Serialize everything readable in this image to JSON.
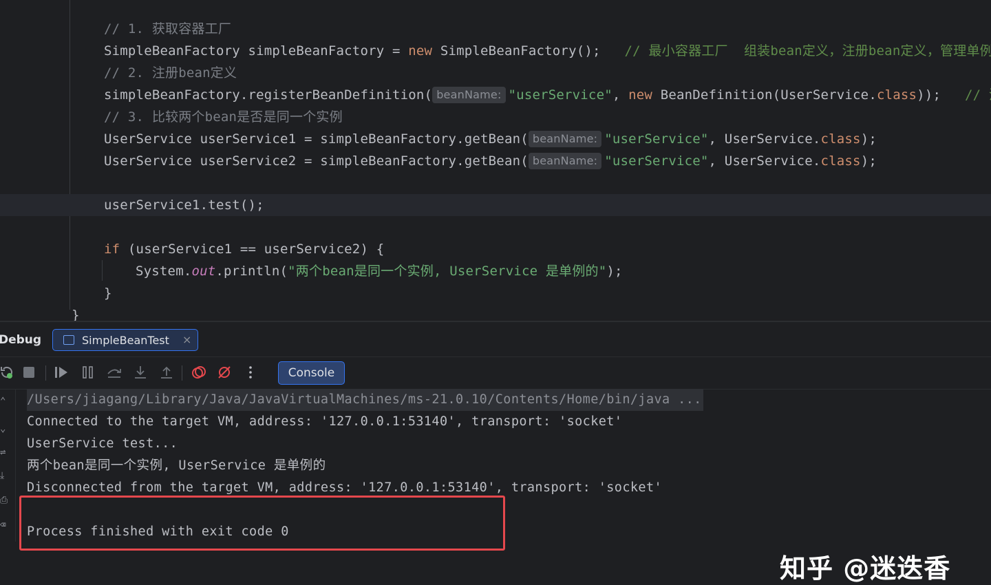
{
  "editor": {
    "lines": [
      {
        "id": "l1",
        "parts": [
          {
            "c": "cm",
            "t": "// 1. 获取容器工厂"
          }
        ]
      },
      {
        "id": "l2",
        "parts": [
          {
            "t": "SimpleBeanFactory simpleBeanFactory = "
          },
          {
            "c": "kw",
            "t": "new"
          },
          {
            "t": " SimpleBeanFactory();   "
          },
          {
            "c": "cmi",
            "t": "// 最小容器工厂  组装bean定义，注册bean定义，管理单例b"
          }
        ]
      },
      {
        "id": "l3",
        "parts": [
          {
            "c": "cm",
            "t": "// 2. 注册bean定义"
          }
        ]
      },
      {
        "id": "l4",
        "parts": [
          {
            "t": "simpleBeanFactory.registerBeanDefinition("
          },
          {
            "c": "hint",
            "t": "beanName:"
          },
          {
            "c": "str",
            "t": "\"userService\""
          },
          {
            "t": ", "
          },
          {
            "c": "kw",
            "t": "new"
          },
          {
            "t": " BeanDefinition(UserService."
          },
          {
            "c": "kw",
            "t": "class"
          },
          {
            "t": "));   "
          },
          {
            "c": "cmi",
            "t": "// 注"
          }
        ]
      },
      {
        "id": "l5",
        "parts": [
          {
            "c": "cm",
            "t": "// 3. 比较两个bean是否是同一个实例"
          }
        ]
      },
      {
        "id": "l6",
        "parts": [
          {
            "t": "UserService userService1 = simpleBeanFactory.getBean("
          },
          {
            "c": "hint",
            "t": "beanName:"
          },
          {
            "c": "str",
            "t": "\"userService\""
          },
          {
            "t": ", UserService."
          },
          {
            "c": "kw",
            "t": "class"
          },
          {
            "t": ");"
          }
        ]
      },
      {
        "id": "l7",
        "parts": [
          {
            "t": "UserService userService2 = simpleBeanFactory.getBean("
          },
          {
            "c": "hint",
            "t": "beanName:"
          },
          {
            "c": "str",
            "t": "\"userService\""
          },
          {
            "t": ", UserService."
          },
          {
            "c": "kw",
            "t": "class"
          },
          {
            "t": ");"
          }
        ]
      },
      {
        "id": "l8",
        "parts": [
          {
            "t": "userService1.test();"
          }
        ]
      },
      {
        "id": "l9",
        "parts": [
          {
            "c": "kw",
            "t": "if"
          },
          {
            "t": " (userService1 == userService2) {"
          }
        ]
      },
      {
        "id": "l10",
        "parts": [
          {
            "t": "System."
          },
          {
            "c": "fld",
            "t": "out"
          },
          {
            "t": ".println("
          },
          {
            "c": "str",
            "t": "\"两个bean是同一个实例, UserService 是单例的\""
          },
          {
            "t": ");"
          }
        ]
      },
      {
        "id": "l11",
        "parts": [
          {
            "t": "}"
          }
        ]
      },
      {
        "id": "l12",
        "parts": [
          {
            "t": "}"
          }
        ]
      }
    ]
  },
  "toolwindow": {
    "title": "Debug",
    "tab_label": "SimpleBeanTest",
    "tab_close": "×",
    "console_button": "Console"
  },
  "console": {
    "lines": [
      "/Users/jiagang/Library/Java/JavaVirtualMachines/ms-21.0.10/Contents/Home/bin/java ...",
      "Connected to the target VM, address: '127.0.0.1:53140', transport: 'socket'",
      "UserService test...",
      "两个bean是同一个实例, UserService 是单例的",
      "Disconnected from the target VM, address: '127.0.0.1:53140', transport: 'socket'",
      "",
      "Process finished with exit code 0"
    ]
  },
  "watermark": "知乎 @迷迭香",
  "colors": {
    "keyword": "#cf8e6d",
    "string": "#6aab73",
    "comment": "#7a7e85",
    "highlight": "#e5484d",
    "accent": "#3574f0"
  }
}
